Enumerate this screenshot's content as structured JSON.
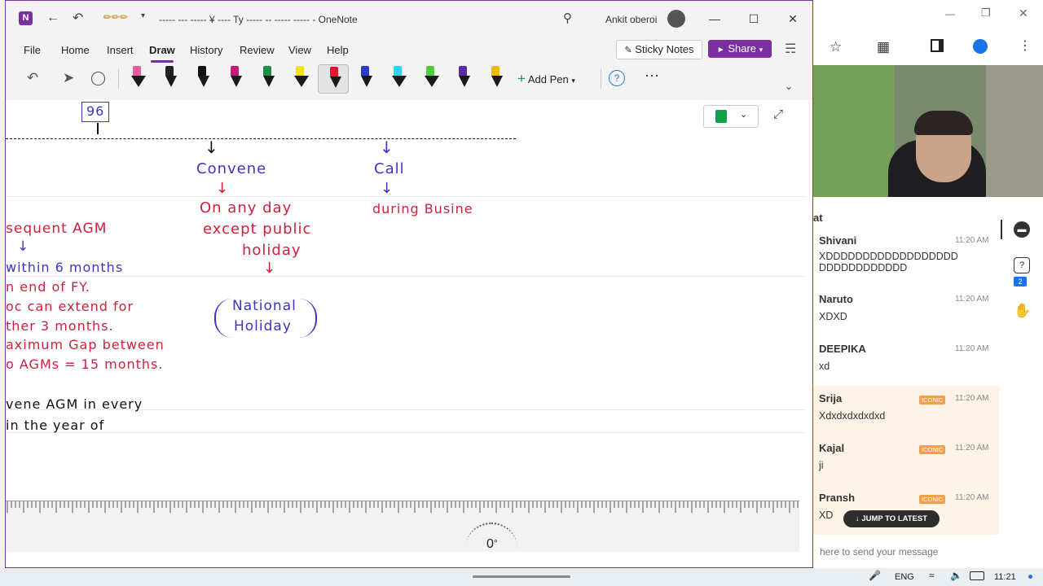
{
  "window": {
    "title": "----- --- ----- ¥ ---- Ty ----- -- ----- -----  -  OneNote",
    "user": "Ankit oberoi",
    "menu": [
      "File",
      "Home",
      "Insert",
      "Draw",
      "History",
      "Review",
      "View",
      "Help"
    ],
    "active_menu": "Draw",
    "sticky_notes": "Sticky Notes",
    "share": "Share",
    "add_pen": "Add Pen",
    "minimize": "—",
    "maximize": "☐",
    "close": "✕"
  },
  "pens": [
    {
      "color": "#e85c9e",
      "kind": "highlighter"
    },
    {
      "color": "#222222",
      "kind": "pencil"
    },
    {
      "color": "#111111",
      "kind": "pen"
    },
    {
      "color": "#c2187a",
      "kind": "pen"
    },
    {
      "color": "#1f8c4a",
      "kind": "pen"
    },
    {
      "color": "#f3e21a",
      "kind": "highlighter"
    },
    {
      "color": "#e3162c",
      "kind": "pen",
      "selected": true
    },
    {
      "color": "#2a3bcc",
      "kind": "pen"
    },
    {
      "color": "#2ed4f2",
      "kind": "highlighter"
    },
    {
      "color": "#4ccf3a",
      "kind": "highlighter"
    },
    {
      "color": "#5a2aa0",
      "kind": "pen"
    },
    {
      "color": "#f0b800",
      "kind": "pen"
    }
  ],
  "note": {
    "box_number": "96",
    "convene": "Convene",
    "call": "Call",
    "on_any_day": "On any day",
    "except_public": "except public",
    "holiday": "holiday",
    "national": "National",
    "national_holiday": "Holiday",
    "during_business": "during Busine",
    "subsequent_agm": "sequent AGM",
    "within_6_months": "within 6 months",
    "end_of_fy": "n end of FY.",
    "rc_extend": "oc can extend for",
    "further_3_months": "ther 3 months.",
    "max_gap": "aximum Gap between",
    "agms_15": "o AGMs = 15 months.",
    "convene_agm": "vene AGM in every",
    "in_year": "in the year of"
  },
  "ruler": {
    "angle": "0",
    "unit": "°"
  },
  "chat": {
    "header": "at",
    "messages": [
      {
        "name": "Shivani",
        "time": "11:20 AM",
        "text": "XDDDDDDDDDDDDDDDDDD DDDDDDDDDDDD"
      },
      {
        "name": "Naruto",
        "time": "11:20 AM",
        "text": "XDXD"
      },
      {
        "name": "DEEPIKA",
        "time": "11:20 AM",
        "text": "xd"
      },
      {
        "name": "Srija",
        "badge": "ICONIC",
        "time": "11:20 AM",
        "text": "Xdxdxdxdxdxd"
      },
      {
        "name": "Kajal",
        "badge": "ICONIC",
        "time": "11:20 AM",
        "text": "ji"
      },
      {
        "name": "Pransh",
        "badge": "ICONIC",
        "time": "11:20 AM",
        "text": "XD"
      }
    ],
    "jump": "JUMP TO LATEST",
    "placeholder": "here to send your message",
    "help_count": "2"
  },
  "taskbar": {
    "lang": "ENG",
    "time": "11:21"
  },
  "colors": {
    "accent": "#7b2fa0",
    "ink_red": "#d1203b",
    "ink_blue": "#3b36c4"
  }
}
